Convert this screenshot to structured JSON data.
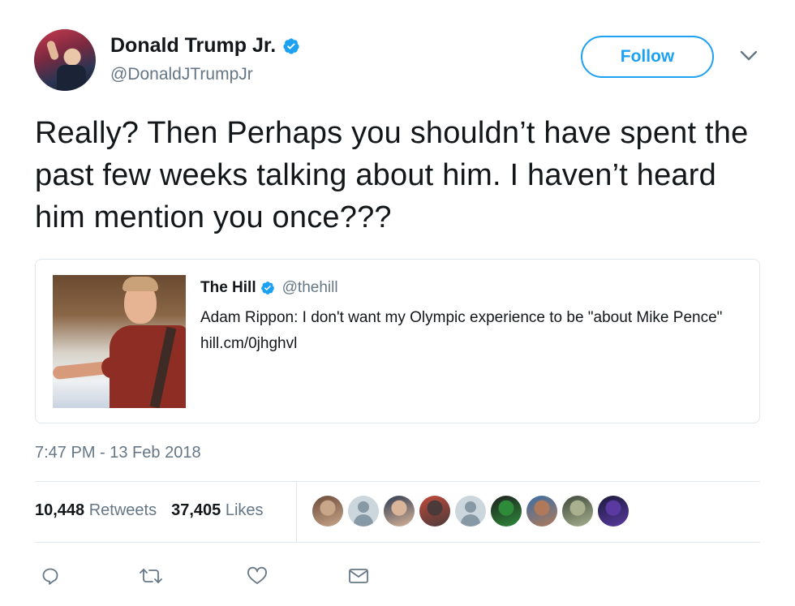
{
  "author": {
    "name": "Donald Trump Jr.",
    "handle": "@DonaldJTrumpJr",
    "verified": true
  },
  "follow_button": {
    "label": "Follow"
  },
  "tweet": {
    "text": "Really? Then Perhaps you shouldn’t have spent the past few weeks talking about him. I haven’t heard him mention you once???",
    "timestamp": "7:47 PM - 13 Feb 2018"
  },
  "quote": {
    "name": "The Hill",
    "handle": "@thehill",
    "verified": true,
    "text": "Adam Rippon: I don't want my Olympic experience to be \"about Mike Pence\" hill.cm/0jhghvl"
  },
  "stats": {
    "retweets_count": "10,448",
    "retweets_label": "Retweets",
    "likes_count": "37,405",
    "likes_label": "Likes"
  },
  "likers": [
    {
      "type": "photo",
      "colors": [
        "#6b4a3a",
        "#c8a68a"
      ]
    },
    {
      "type": "default"
    },
    {
      "type": "photo",
      "colors": [
        "#2f3b52",
        "#d9b59a"
      ]
    },
    {
      "type": "photo",
      "colors": [
        "#c04a3a",
        "#4a3a3a"
      ]
    },
    {
      "type": "default"
    },
    {
      "type": "photo",
      "colors": [
        "#1f1f1f",
        "#2e8b3a"
      ]
    },
    {
      "type": "photo",
      "colors": [
        "#3a6ea5",
        "#b07a5a"
      ]
    },
    {
      "type": "photo",
      "colors": [
        "#3d4a3a",
        "#a8b090"
      ]
    },
    {
      "type": "photo",
      "colors": [
        "#1a1a3a",
        "#5a3aa0"
      ]
    }
  ],
  "colors": {
    "accent": "#1da1f2",
    "secondary_text": "#657786",
    "border": "#e1e8ed"
  },
  "icons": {
    "reply": "reply-icon",
    "retweet": "retweet-icon",
    "like": "heart-icon",
    "dm": "envelope-icon",
    "more": "chevron-down-icon"
  }
}
